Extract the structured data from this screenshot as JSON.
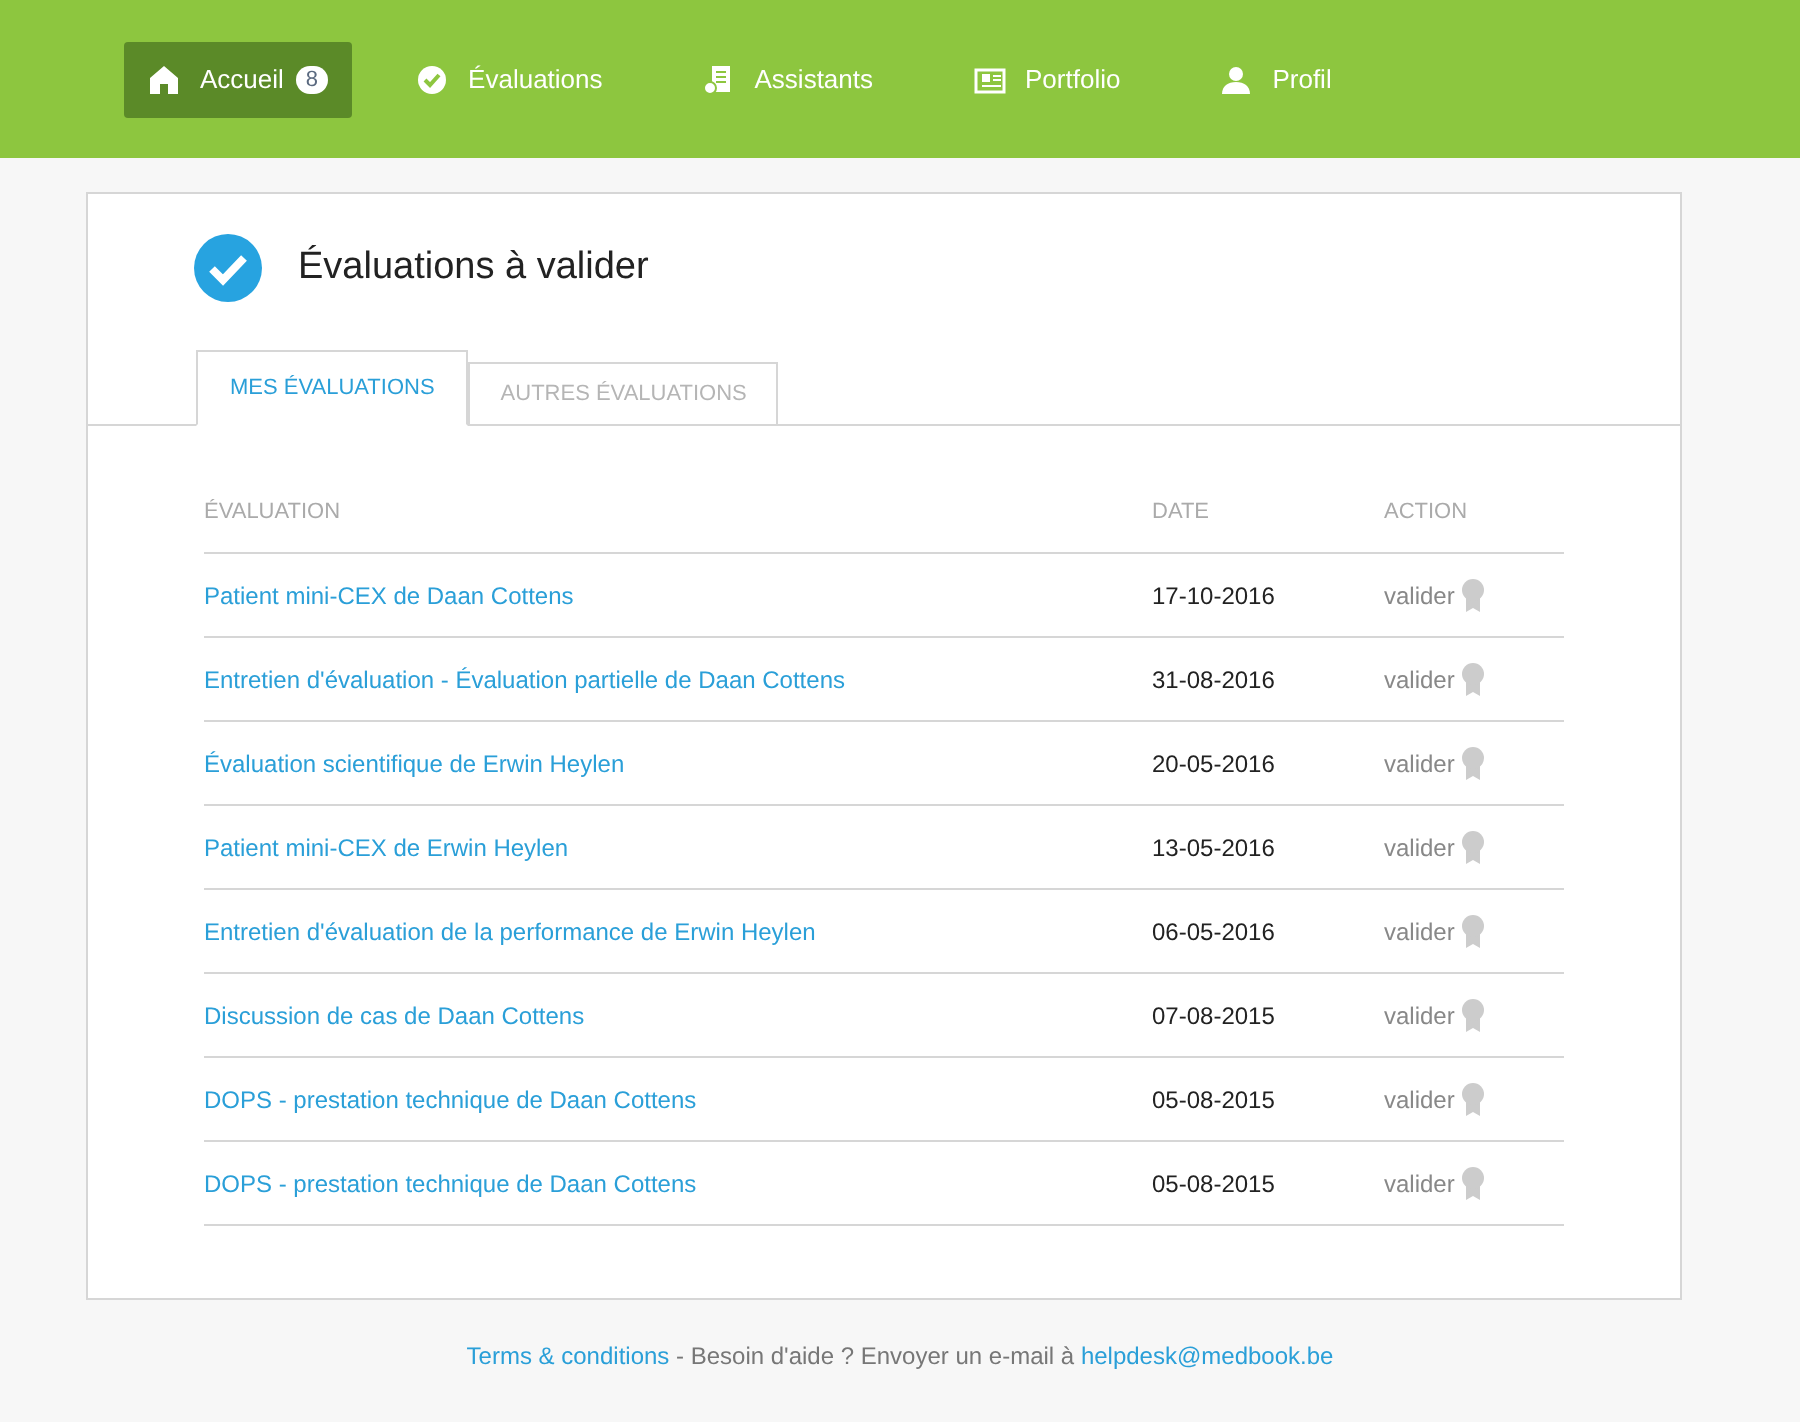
{
  "nav": [
    {
      "kind": "home",
      "label": "Accueil",
      "badge": "8",
      "selected": true
    },
    {
      "kind": "check",
      "label": "Évaluations",
      "selected": false
    },
    {
      "kind": "assistants",
      "label": "Assistants",
      "selected": false
    },
    {
      "kind": "portfolio",
      "label": "Portfolio",
      "selected": false
    },
    {
      "kind": "profile",
      "label": "Profil",
      "selected": false
    }
  ],
  "title": "Évaluations à valider",
  "tabs": [
    {
      "label": "MES ÉVALUATIONS",
      "selected": true
    },
    {
      "label": "AUTRES ÉVALUATIONS",
      "selected": false
    }
  ],
  "table": {
    "columns": [
      "ÉVALUATION",
      "DATE",
      "ACTION"
    ],
    "rows": [
      {
        "evaluation": "Patient mini-CEX de Daan Cottens",
        "date": "17-10-2016",
        "action": "valider"
      },
      {
        "evaluation": "Entretien d'évaluation - Évaluation partielle de Daan Cottens",
        "date": "31-08-2016",
        "action": "valider"
      },
      {
        "evaluation": "Évaluation scientifique de Erwin Heylen",
        "date": "20-05-2016",
        "action": "valider"
      },
      {
        "evaluation": "Patient mini-CEX de Erwin Heylen",
        "date": "13-05-2016",
        "action": "valider"
      },
      {
        "evaluation": "Entretien d'évaluation de la performance de Erwin Heylen",
        "date": "06-05-2016",
        "action": "valider"
      },
      {
        "evaluation": "Discussion de cas de Daan Cottens",
        "date": "07-08-2015",
        "action": "valider"
      },
      {
        "evaluation": "DOPS - prestation technique de Daan Cottens",
        "date": "05-08-2015",
        "action": "valider"
      },
      {
        "evaluation": "DOPS - prestation technique de Daan Cottens",
        "date": "05-08-2015",
        "action": "valider"
      }
    ]
  },
  "footer": {
    "terms": "Terms & conditions",
    "text": "- Besoin d'aide ? Envoyer un e-mail à",
    "email": "helpdesk@medbook.be"
  }
}
